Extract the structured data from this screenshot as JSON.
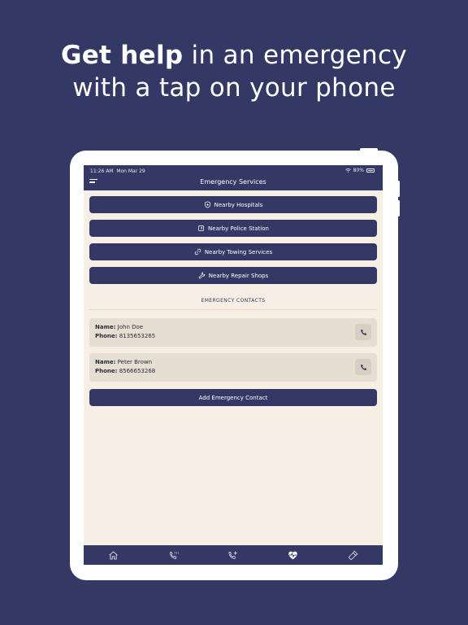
{
  "headline": {
    "line1_bold": "Get help",
    "line1_rest": " in an emergency",
    "line2": "with a tap on your phone"
  },
  "status_bar": {
    "time": "11:26 AM",
    "date": "Mon Mar 29",
    "battery": "80%"
  },
  "header": {
    "title": "Emergency Services",
    "menu_icon": "hamburger-menu-icon"
  },
  "services": [
    {
      "label": "Nearby Hospitals",
      "icon": "shield-plus-icon"
    },
    {
      "label": "Nearby Police Station",
      "icon": "police-badge-icon"
    },
    {
      "label": "Nearby Towing Services",
      "icon": "link-icon"
    },
    {
      "label": "Nearby Repair Shops",
      "icon": "wrench-icon"
    }
  ],
  "contacts_section": {
    "title": "EMERGENCY CONTACTS",
    "name_label": "Name:",
    "phone_label": "Phone:",
    "contacts": [
      {
        "name": "John Doe",
        "phone": "8135653265"
      },
      {
        "name": "Peter Brown",
        "phone": "8566653268"
      }
    ],
    "add_label": "Add Emergency Contact"
  },
  "tabbar": {
    "tabs": [
      {
        "icon": "home-icon"
      },
      {
        "icon": "phone-911-icon"
      },
      {
        "icon": "phone-add-icon"
      },
      {
        "icon": "heartbeat-icon",
        "active": true
      },
      {
        "icon": "flashlight-icon"
      }
    ]
  },
  "colors": {
    "background": "#343864",
    "screen": "#f7efe5",
    "card": "#e5ded2",
    "accent": "#343864"
  }
}
